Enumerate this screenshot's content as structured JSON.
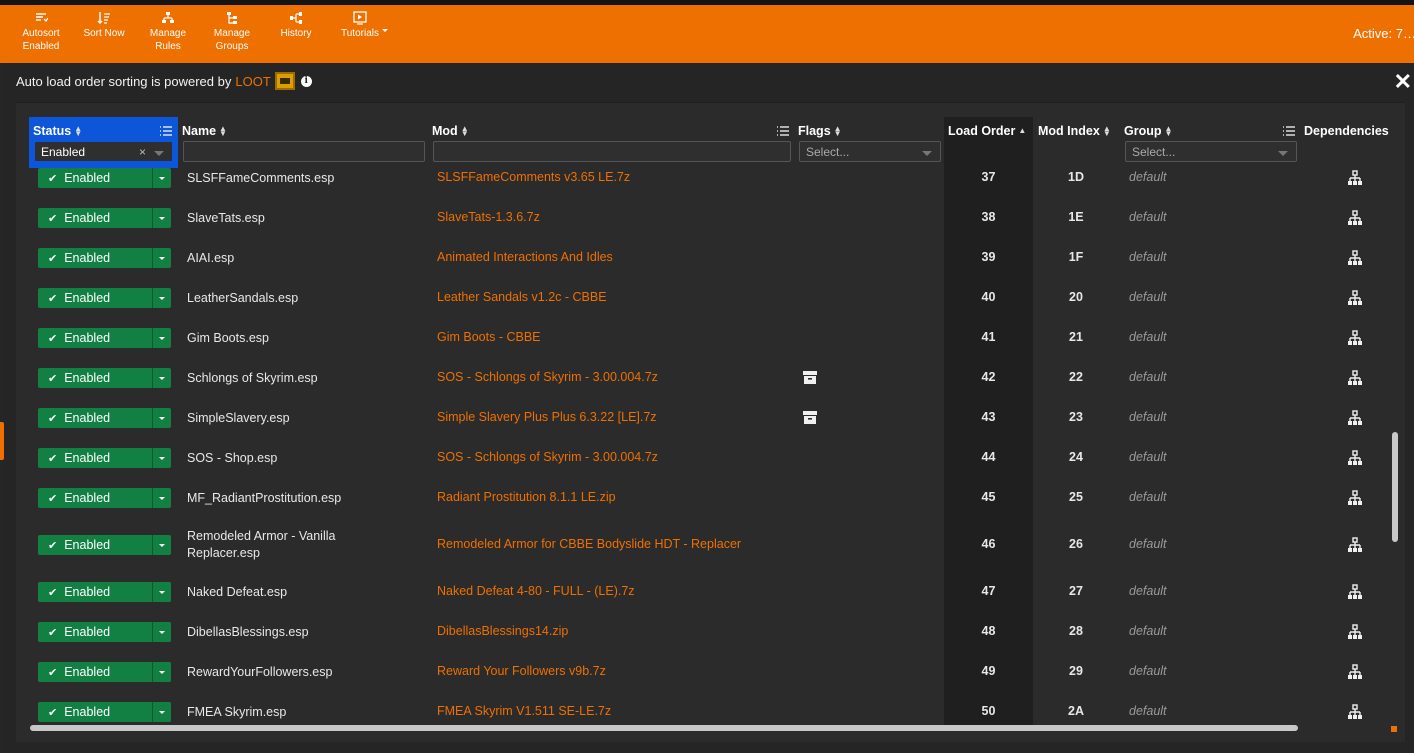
{
  "toolbar": {
    "buttons": [
      {
        "label": "Autosort\nEnabled",
        "icon": "autosort-icon"
      },
      {
        "label": "Sort Now",
        "icon": "sort-icon"
      },
      {
        "label": "Manage\nRules",
        "icon": "rules-icon"
      },
      {
        "label": "Manage\nGroups",
        "icon": "groups-icon"
      },
      {
        "label": "History",
        "icon": "history-icon"
      },
      {
        "label": "Tutorials",
        "icon": "tutorials-icon"
      }
    ],
    "active_text": "Active: 7…",
    "color": "#ee7000"
  },
  "notice": {
    "text": "Auto load order sorting is powered by",
    "link": "LOOT",
    "info": "i"
  },
  "close_symbol": "✕",
  "columns": {
    "status": "Status",
    "name": "Name",
    "mod": "Mod",
    "flags": "Flags",
    "load_order": "Load Order",
    "mod_index": "Mod Index",
    "group": "Group",
    "dependencies": "Dependencies"
  },
  "filters": {
    "status_value": "Enabled",
    "status_clear": "×",
    "name_value": "",
    "mod_value": "",
    "flags_placeholder": "Select...",
    "group_placeholder": "Select..."
  },
  "rows": [
    {
      "status": "Enabled",
      "name": "SLSFFameComments.esp",
      "mod": "SLSFFameComments v3.65 LE.7z",
      "flag": false,
      "load_order": "37",
      "mod_index": "1D",
      "group": "default"
    },
    {
      "status": "Enabled",
      "name": "SlaveTats.esp",
      "mod": "SlaveTats-1.3.6.7z",
      "flag": false,
      "load_order": "38",
      "mod_index": "1E",
      "group": "default"
    },
    {
      "status": "Enabled",
      "name": "AIAI.esp",
      "mod": "Animated Interactions And Idles",
      "flag": false,
      "load_order": "39",
      "mod_index": "1F",
      "group": "default"
    },
    {
      "status": "Enabled",
      "name": "LeatherSandals.esp",
      "mod": "Leather Sandals v1.2c - CBBE",
      "flag": false,
      "load_order": "40",
      "mod_index": "20",
      "group": "default"
    },
    {
      "status": "Enabled",
      "name": "Gim Boots.esp",
      "mod": "Gim Boots - CBBE",
      "flag": false,
      "load_order": "41",
      "mod_index": "21",
      "group": "default"
    },
    {
      "status": "Enabled",
      "name": "Schlongs of Skyrim.esp",
      "mod": "SOS - Schlongs of Skyrim - 3.00.004.7z",
      "flag": true,
      "load_order": "42",
      "mod_index": "22",
      "group": "default"
    },
    {
      "status": "Enabled",
      "name": "SimpleSlavery.esp",
      "mod": "Simple Slavery Plus Plus 6.3.22 [LE].7z",
      "flag": true,
      "load_order": "43",
      "mod_index": "23",
      "group": "default"
    },
    {
      "status": "Enabled",
      "name": "SOS - Shop.esp",
      "mod": "SOS - Schlongs of Skyrim - 3.00.004.7z",
      "flag": false,
      "load_order": "44",
      "mod_index": "24",
      "group": "default"
    },
    {
      "status": "Enabled",
      "name": "MF_RadiantProstitution.esp",
      "mod": "Radiant Prostitution 8.1.1 LE.zip",
      "flag": false,
      "load_order": "45",
      "mod_index": "25",
      "group": "default"
    },
    {
      "status": "Enabled",
      "name": "Remodeled Armor - Vanilla Replacer.esp",
      "mod": "Remodeled Armor for CBBE Bodyslide HDT - Replacer",
      "flag": false,
      "load_order": "46",
      "mod_index": "26",
      "group": "default"
    },
    {
      "status": "Enabled",
      "name": "Naked Defeat.esp",
      "mod": "Naked Defeat 4-80 - FULL - (LE).7z",
      "flag": false,
      "load_order": "47",
      "mod_index": "27",
      "group": "default"
    },
    {
      "status": "Enabled",
      "name": "DibellasBlessings.esp",
      "mod": "DibellasBlessings14.zip",
      "flag": false,
      "load_order": "48",
      "mod_index": "28",
      "group": "default"
    },
    {
      "status": "Enabled",
      "name": "RewardYourFollowers.esp",
      "mod": "Reward Your Followers v9b.7z",
      "flag": false,
      "load_order": "49",
      "mod_index": "29",
      "group": "default"
    },
    {
      "status": "Enabled",
      "name": "FMEA Skyrim.esp",
      "mod": "FMEA Skyrim V1.511 SE-LE.7z",
      "flag": false,
      "load_order": "50",
      "mod_index": "2A",
      "group": "default"
    }
  ],
  "colors": {
    "accent": "#ee7000",
    "status_enabled": "#118042",
    "status_header_highlight": "#0d55d9"
  }
}
